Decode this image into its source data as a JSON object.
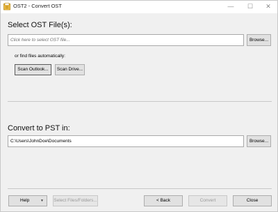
{
  "window": {
    "title": "OST2 - Convert OST"
  },
  "select_section": {
    "title": "Select OST File(s):",
    "file_input_placeholder": "Click here to select OST file...",
    "browse_label": "Browse...",
    "auto_find_label": "or find files automatically:",
    "scan_outlook_label": "Scan Outlook...",
    "scan_drive_label": "Scan Drive..."
  },
  "convert_section": {
    "title": "Convert to PST in:",
    "output_path": "C:\\Users\\JohnDoe\\Documents",
    "browse_label": "Browse..."
  },
  "footer": {
    "help_label": "Help",
    "select_files_label": "Select Files/Folders...",
    "back_label": "< Back",
    "convert_label": "Convert",
    "close_label": "Close"
  }
}
